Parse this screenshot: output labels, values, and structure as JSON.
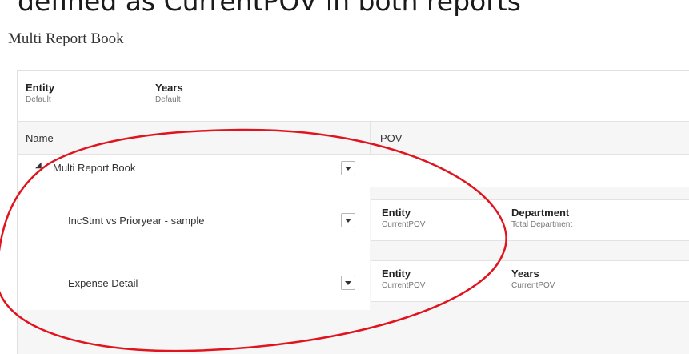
{
  "caption": "defined as CurrentPOV in both reports",
  "book_title": "Multi Report Book",
  "pov_bar": {
    "dimensions": [
      {
        "label": "Entity",
        "value": "Default"
      },
      {
        "label": "Years",
        "value": "Default"
      }
    ]
  },
  "grid": {
    "columns": {
      "name": "Name",
      "pov": "POV"
    },
    "rows": [
      {
        "label": "Multi Report Book",
        "expander": "◢",
        "pov": []
      },
      {
        "label": "IncStmt vs Prioryear - sample",
        "pov": [
          {
            "label": "Entity",
            "value": "CurrentPOV"
          },
          {
            "label": "Department",
            "value": "Total Department"
          }
        ]
      },
      {
        "label": "Expense Detail",
        "pov": [
          {
            "label": "Entity",
            "value": "CurrentPOV"
          },
          {
            "label": "Years",
            "value": "CurrentPOV"
          }
        ]
      }
    ]
  },
  "colors": {
    "annotation": "#e0141e",
    "header_bg": "#f6f6f6",
    "border": "#e3e3e3"
  },
  "icons": {
    "expander": "collapse-triangle-icon",
    "row_menu": "dropdown-arrow-icon"
  }
}
